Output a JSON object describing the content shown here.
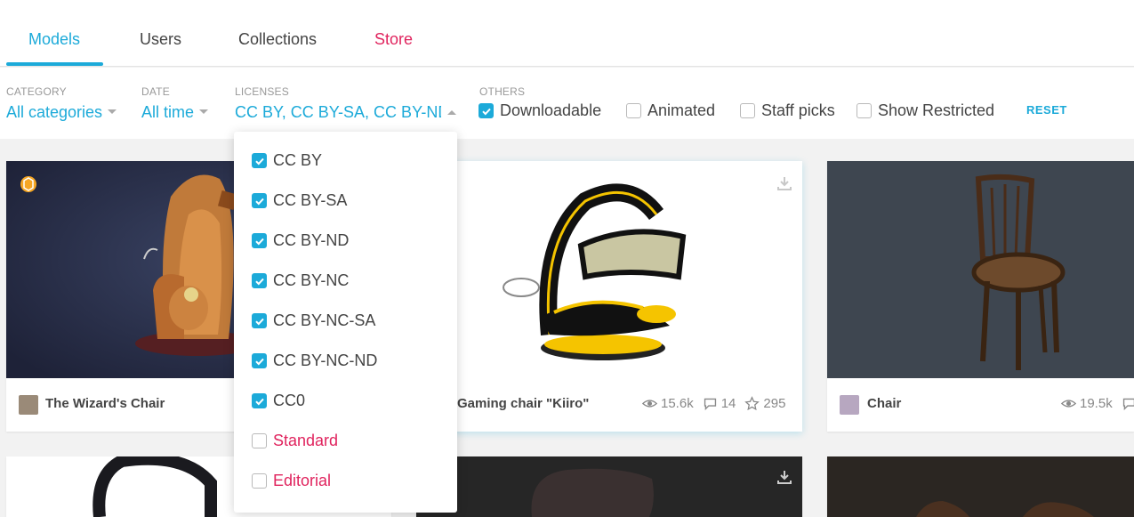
{
  "tabs": [
    {
      "label": "Models"
    },
    {
      "label": "Users"
    },
    {
      "label": "Collections"
    },
    {
      "label": "Store"
    }
  ],
  "filters": {
    "category": {
      "label": "CATEGORY",
      "value": "All categories"
    },
    "date": {
      "label": "DATE",
      "value": "All time"
    },
    "licenses": {
      "label": "LICENSES",
      "value": "CC BY, CC BY-SA, CC BY-ND, C"
    },
    "others": {
      "label": "OTHERS",
      "options": [
        {
          "label": "Downloadable",
          "checked": true
        },
        {
          "label": "Animated",
          "checked": false
        },
        {
          "label": "Staff picks",
          "checked": false
        },
        {
          "label": "Show Restricted",
          "checked": false
        }
      ]
    },
    "reset_label": "RESET"
  },
  "license_dropdown": [
    {
      "label": "CC BY",
      "checked": true
    },
    {
      "label": "CC BY-SA",
      "checked": true
    },
    {
      "label": "CC BY-ND",
      "checked": true
    },
    {
      "label": "CC BY-NC",
      "checked": true
    },
    {
      "label": "CC BY-NC-SA",
      "checked": true
    },
    {
      "label": "CC BY-NC-ND",
      "checked": true
    },
    {
      "label": "CC0",
      "checked": true
    },
    {
      "label": "Standard",
      "checked": false
    },
    {
      "label": "Editorial",
      "checked": false
    }
  ],
  "cards": [
    {
      "title": "The Wizard's Chair"
    },
    {
      "title": "Gaming chair \"Kiiro\"",
      "views": "15.6k",
      "comments": "14",
      "likes": "295"
    },
    {
      "title": "Chair",
      "views": "19.5k"
    }
  ],
  "colors": {
    "accent": "#1caad9",
    "store": "#e0245e"
  }
}
